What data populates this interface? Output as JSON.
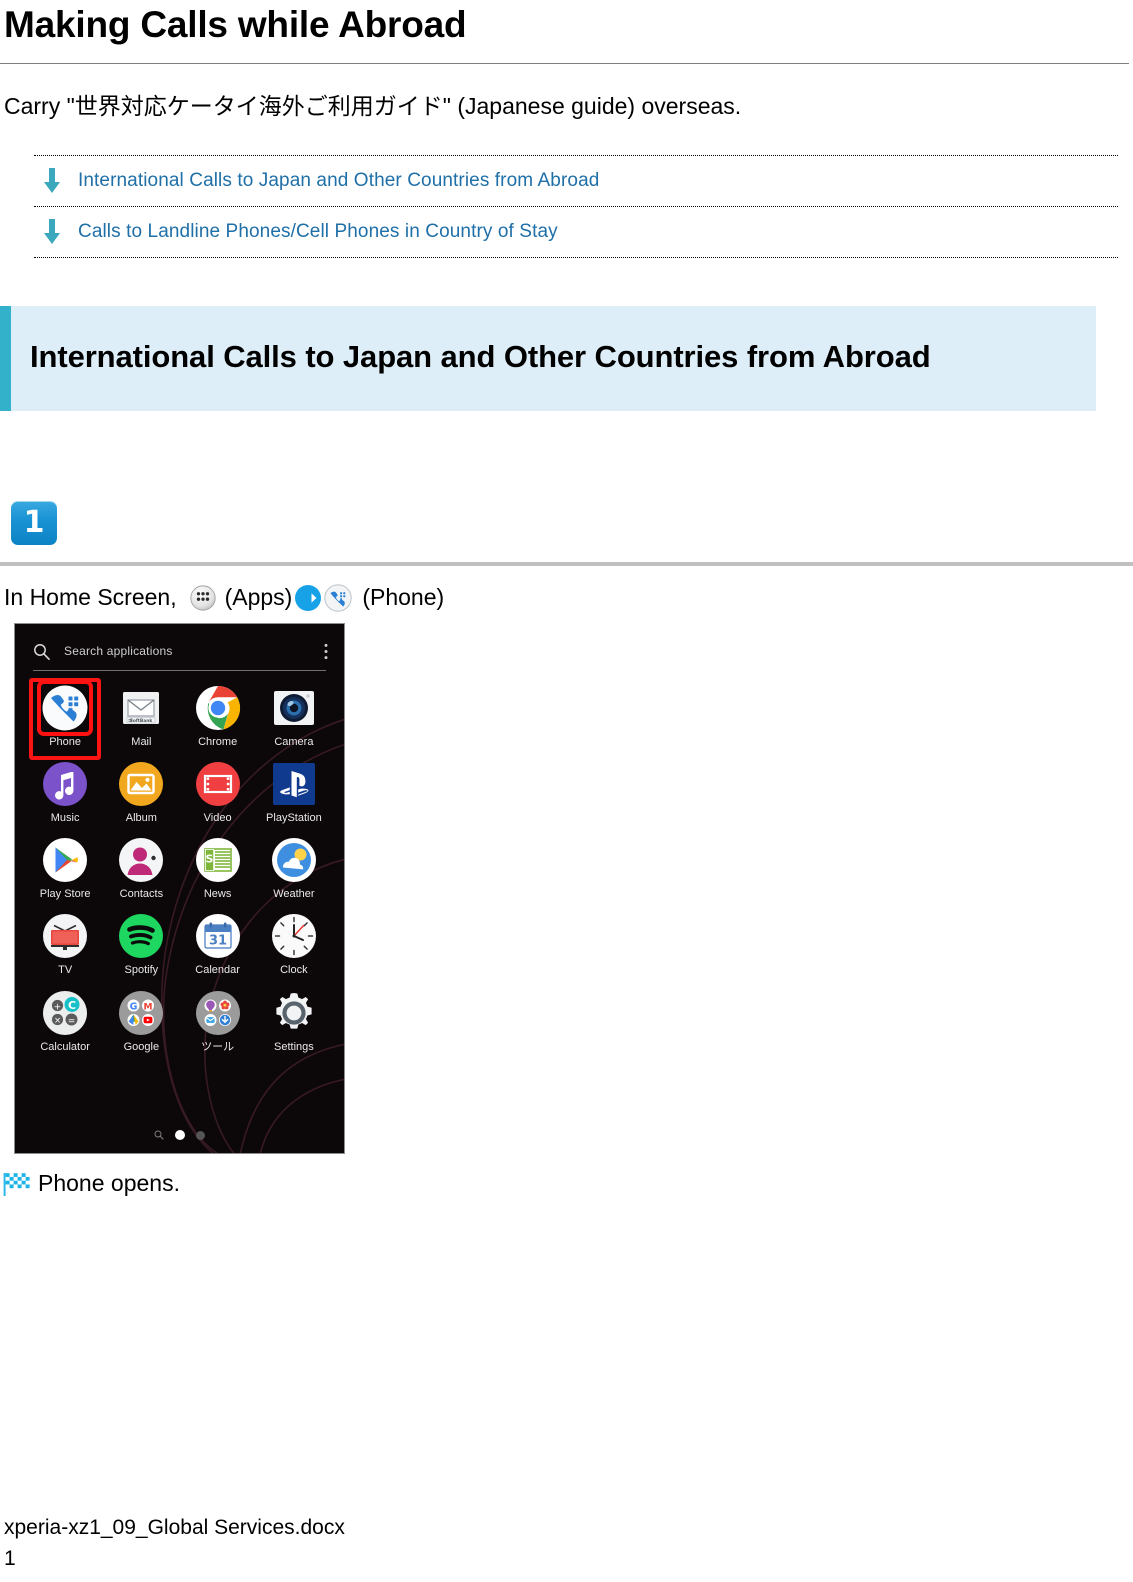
{
  "document": {
    "title": "Making Calls while Abroad",
    "intro": "Carry \"世界対応ケータイ海外ご利用ガイド\" (Japanese guide) overseas."
  },
  "jump_links": [
    {
      "label": "International Calls to Japan and Other Countries from Abroad",
      "icon": "arrow-down-icon"
    },
    {
      "label": "Calls to Landline Phones/Cell Phones in Country of Stay",
      "icon": "arrow-down-icon"
    }
  ],
  "section": {
    "heading": "International Calls to Japan and Other Countries from Abroad",
    "accent_color": "#33b0ca",
    "background_color": "#ddeef8"
  },
  "step": {
    "number": "1",
    "badge_color": "#0b82c4",
    "instruction_prefix": "In Home Screen,",
    "apps_label": "(Apps)",
    "phone_label": "(Phone)",
    "result_text": "Phone opens."
  },
  "phone_screenshot": {
    "search_placeholder": "Search applications",
    "apps": [
      {
        "label": "Phone",
        "icon": "phone-app-icon",
        "highlighted": true
      },
      {
        "label": "Mail",
        "icon": "mail-app-icon",
        "highlighted": false
      },
      {
        "label": "Chrome",
        "icon": "chrome-app-icon",
        "highlighted": false
      },
      {
        "label": "Camera",
        "icon": "camera-app-icon",
        "highlighted": false
      },
      {
        "label": "Music",
        "icon": "music-app-icon",
        "highlighted": false
      },
      {
        "label": "Album",
        "icon": "album-app-icon",
        "highlighted": false
      },
      {
        "label": "Video",
        "icon": "video-app-icon",
        "highlighted": false
      },
      {
        "label": "PlayStation",
        "icon": "playstation-app-icon",
        "highlighted": false
      },
      {
        "label": "Play Store",
        "icon": "play-store-app-icon",
        "highlighted": false
      },
      {
        "label": "Contacts",
        "icon": "contacts-app-icon",
        "highlighted": false
      },
      {
        "label": "News",
        "icon": "news-app-icon",
        "highlighted": false
      },
      {
        "label": "Weather",
        "icon": "weather-app-icon",
        "highlighted": false
      },
      {
        "label": "TV",
        "icon": "tv-app-icon",
        "highlighted": false
      },
      {
        "label": "Spotify",
        "icon": "spotify-app-icon",
        "highlighted": false
      },
      {
        "label": "Calendar",
        "icon": "calendar-app-icon",
        "highlighted": false
      },
      {
        "label": "Clock",
        "icon": "clock-app-icon",
        "highlighted": false
      },
      {
        "label": "Calculator",
        "icon": "calculator-app-icon",
        "highlighted": false
      },
      {
        "label": "Google",
        "icon": "google-folder-icon",
        "highlighted": false
      },
      {
        "label": "ツール",
        "icon": "tools-folder-icon",
        "highlighted": false
      },
      {
        "label": "Settings",
        "icon": "settings-app-icon",
        "highlighted": false
      }
    ],
    "calendar_day": "31",
    "page_indicator": {
      "pages": 2,
      "active": 1
    }
  },
  "footer": {
    "filename": "xperia-xz1_09_Global Services.docx",
    "page_number": "1"
  }
}
